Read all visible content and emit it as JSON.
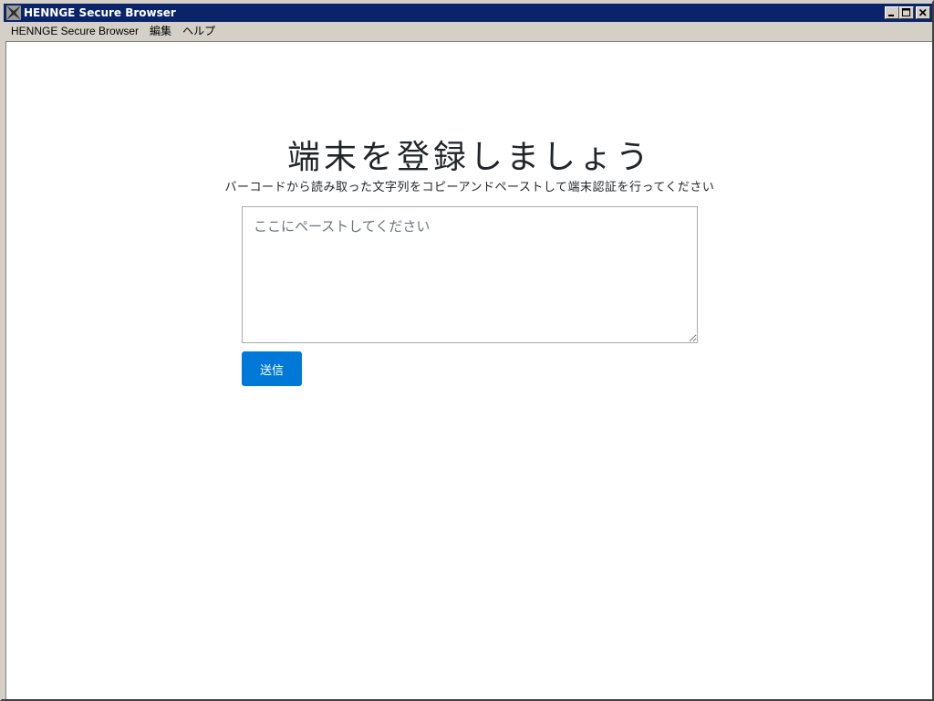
{
  "window": {
    "title": "HENNGE Secure Browser",
    "buttons": [
      "minimize",
      "maximize",
      "close"
    ]
  },
  "menubar": {
    "items": [
      "HENNGE Secure Browser",
      "編集",
      "ヘルプ"
    ]
  },
  "page": {
    "heading": "端末を登録しましょう",
    "subtext": "バーコードから読み取った文字列をコピーアンドペーストして端末認証を行ってください",
    "textarea_placeholder": "ここにペーストしてください",
    "textarea_value": "",
    "submit_label": "送信"
  },
  "colors": {
    "titlebar": "#0a246a",
    "button": "#0078d7",
    "chrome": "#d4d0c8"
  }
}
